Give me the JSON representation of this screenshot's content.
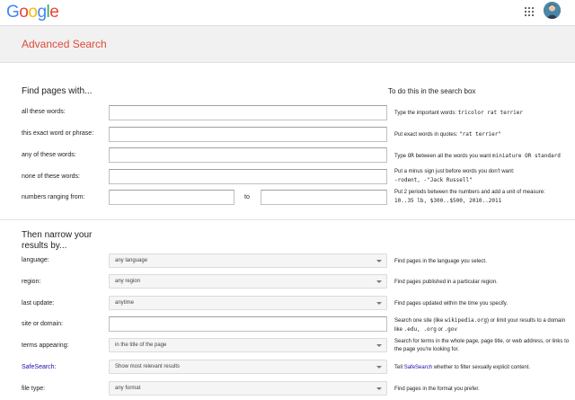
{
  "header": {
    "logo_letters": [
      {
        "ch": "G",
        "color": "#4285f4"
      },
      {
        "ch": "o",
        "color": "#ea4335"
      },
      {
        "ch": "o",
        "color": "#fbbc05"
      },
      {
        "ch": "g",
        "color": "#4285f4"
      },
      {
        "ch": "l",
        "color": "#34a853"
      },
      {
        "ch": "e",
        "color": "#ea4335"
      }
    ],
    "apps_icon": "apps-grid-icon",
    "avatar_icon": "user-avatar"
  },
  "page": {
    "title": "Advanced Search"
  },
  "find": {
    "heading": "Find pages with...",
    "right_heading": "To do this in the search box",
    "all_words_label": "all these words:",
    "all_words_value": "",
    "all_words_help_text": "Type the important words:",
    "all_words_help_code": "tricolor rat terrier",
    "exact_label": "this exact word or phrase:",
    "exact_value": "",
    "exact_help_text": "Put exact words in quotes:",
    "exact_help_code": "\"rat terrier\"",
    "any_label": "any of these words:",
    "any_value": "",
    "any_help_a": "Type",
    "any_help_code_a": "OR",
    "any_help_b": "between all the words you want",
    "any_help_code_b": "miniature OR standard",
    "none_label": "none of these words:",
    "none_value": "",
    "none_help_text": "Put a minus sign just before words you don't want:",
    "none_help_code": "-rodent, -\"Jack Russell\"",
    "range_label": "numbers ranging from:",
    "range_from_value": "",
    "range_to_label": "to",
    "range_to_value": "",
    "range_help_text": "Put 2 periods between the numbers and add a unit of measure:",
    "range_help_code": "10..35 lb, $300..$500, 2010..2011"
  },
  "narrow": {
    "heading_line1": "Then narrow your",
    "heading_line2": "results by...",
    "language_label": "language:",
    "language_value": "any language",
    "language_help": "Find pages in the language you select.",
    "region_label": "region:",
    "region_value": "any region",
    "region_help": "Find pages published in a particular region.",
    "update_label": "last update:",
    "update_value": "anytime",
    "update_help": "Find pages updated within the time you specify.",
    "site_label": "site or domain:",
    "site_value": "",
    "site_help_a": "Search one site (like",
    "site_help_code_a": "wikipedia.org",
    "site_help_b": ") or limit your results to a domain like",
    "site_help_code_b": ".edu, .org",
    "site_help_c": "or",
    "site_help_code_c": ".gov",
    "terms_label": "terms appearing:",
    "terms_value": "in the title of the page",
    "terms_help": "Search for terms in the whole page, page title, or web address, or links to the page you're looking for.",
    "safe_label": "SafeSearch:",
    "safe_value": "Show most relevant results",
    "safe_help_a": "Tell",
    "safe_help_link": "SafeSearch",
    "safe_help_b": "whether to filter sexually explicit content.",
    "filetype_label": "file type:",
    "filetype_value": "any format",
    "filetype_help": "Find pages in the format you prefer."
  }
}
